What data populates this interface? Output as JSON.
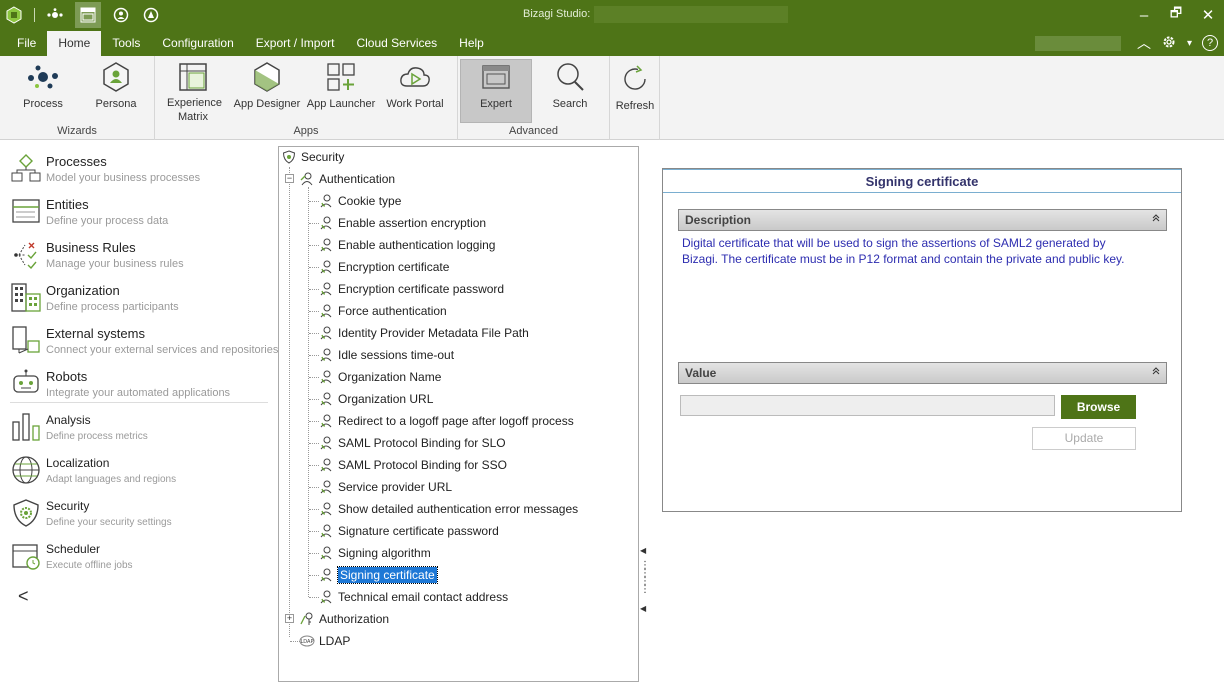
{
  "window": {
    "title": "Bizagi Studio:"
  },
  "window_controls": {
    "minimize": "–",
    "restore": "🗗",
    "close": "✕"
  },
  "menu": {
    "items": [
      {
        "label": "File",
        "active": false
      },
      {
        "label": "Home",
        "active": true
      },
      {
        "label": "Tools",
        "active": false
      },
      {
        "label": "Configuration",
        "active": false
      },
      {
        "label": "Export / Import",
        "active": false
      },
      {
        "label": "Cloud Services",
        "active": false
      },
      {
        "label": "Help",
        "active": false
      }
    ],
    "right": {
      "collapse": "︿",
      "settings_icon": "gear-icon",
      "settings_caret": "▾",
      "help": "?"
    }
  },
  "ribbon": {
    "groups": [
      {
        "label": "Wizards"
      },
      {
        "label": "Apps"
      },
      {
        "label": "Advanced"
      }
    ],
    "buttons": [
      {
        "label": "Process"
      },
      {
        "label": "Persona"
      },
      {
        "label": "Experience Matrix"
      },
      {
        "label": "App Designer"
      },
      {
        "label": "App Launcher"
      },
      {
        "label": "Work Portal"
      },
      {
        "label": "Expert"
      },
      {
        "label": "Search"
      },
      {
        "label": "Refresh"
      }
    ]
  },
  "nav": {
    "items": [
      {
        "title": "Processes",
        "subtitle": "Model your business processes"
      },
      {
        "title": "Entities",
        "subtitle": "Define your process data"
      },
      {
        "title": "Business Rules",
        "subtitle": "Manage your business rules"
      },
      {
        "title": "Organization",
        "subtitle": "Define process participants"
      },
      {
        "title": "External systems",
        "subtitle": "Connect your external services and repositories"
      },
      {
        "title": "Robots",
        "subtitle": "Integrate your automated applications"
      },
      {
        "title": "Analysis",
        "subtitle": "Define process metrics"
      },
      {
        "title": "Localization",
        "subtitle": "Adapt languages and regions"
      },
      {
        "title": "Security",
        "subtitle": "Define your security settings"
      },
      {
        "title": "Scheduler",
        "subtitle": "Execute offline jobs"
      }
    ],
    "collapse": "<"
  },
  "tree": {
    "root": "Security",
    "authentication": "Authentication",
    "children": [
      "Cookie type",
      "Enable assertion encryption",
      "Enable authentication logging",
      "Encryption certificate",
      "Encryption certificate password",
      "Force authentication",
      "Identity Provider Metadata File Path",
      "Idle sessions time-out",
      "Organization Name",
      "Organization URL",
      "Redirect to a logoff page after logoff process",
      "SAML Protocol Binding for SLO",
      "SAML Protocol Binding for SSO",
      "Service provider URL",
      "Show detailed authentication error messages",
      "Signature certificate password",
      "Signing algorithm",
      "Signing certificate",
      "Technical email contact address"
    ],
    "selected": "Signing certificate",
    "authorization": "Authorization",
    "ldap": "LDAP",
    "expand_minus": "−",
    "expand_plus": "+"
  },
  "detail": {
    "title": "Signing certificate",
    "description_header": "Description",
    "description": "Digital certificate that will be used to sign the assertions of SAML2 generated by Bizagi. The certificate must be in P12 format and contain the private and public key.",
    "value_header": "Value",
    "collapse_chevron": "⌃",
    "value": "",
    "browse_label": "Browse",
    "update_label": "Update"
  }
}
